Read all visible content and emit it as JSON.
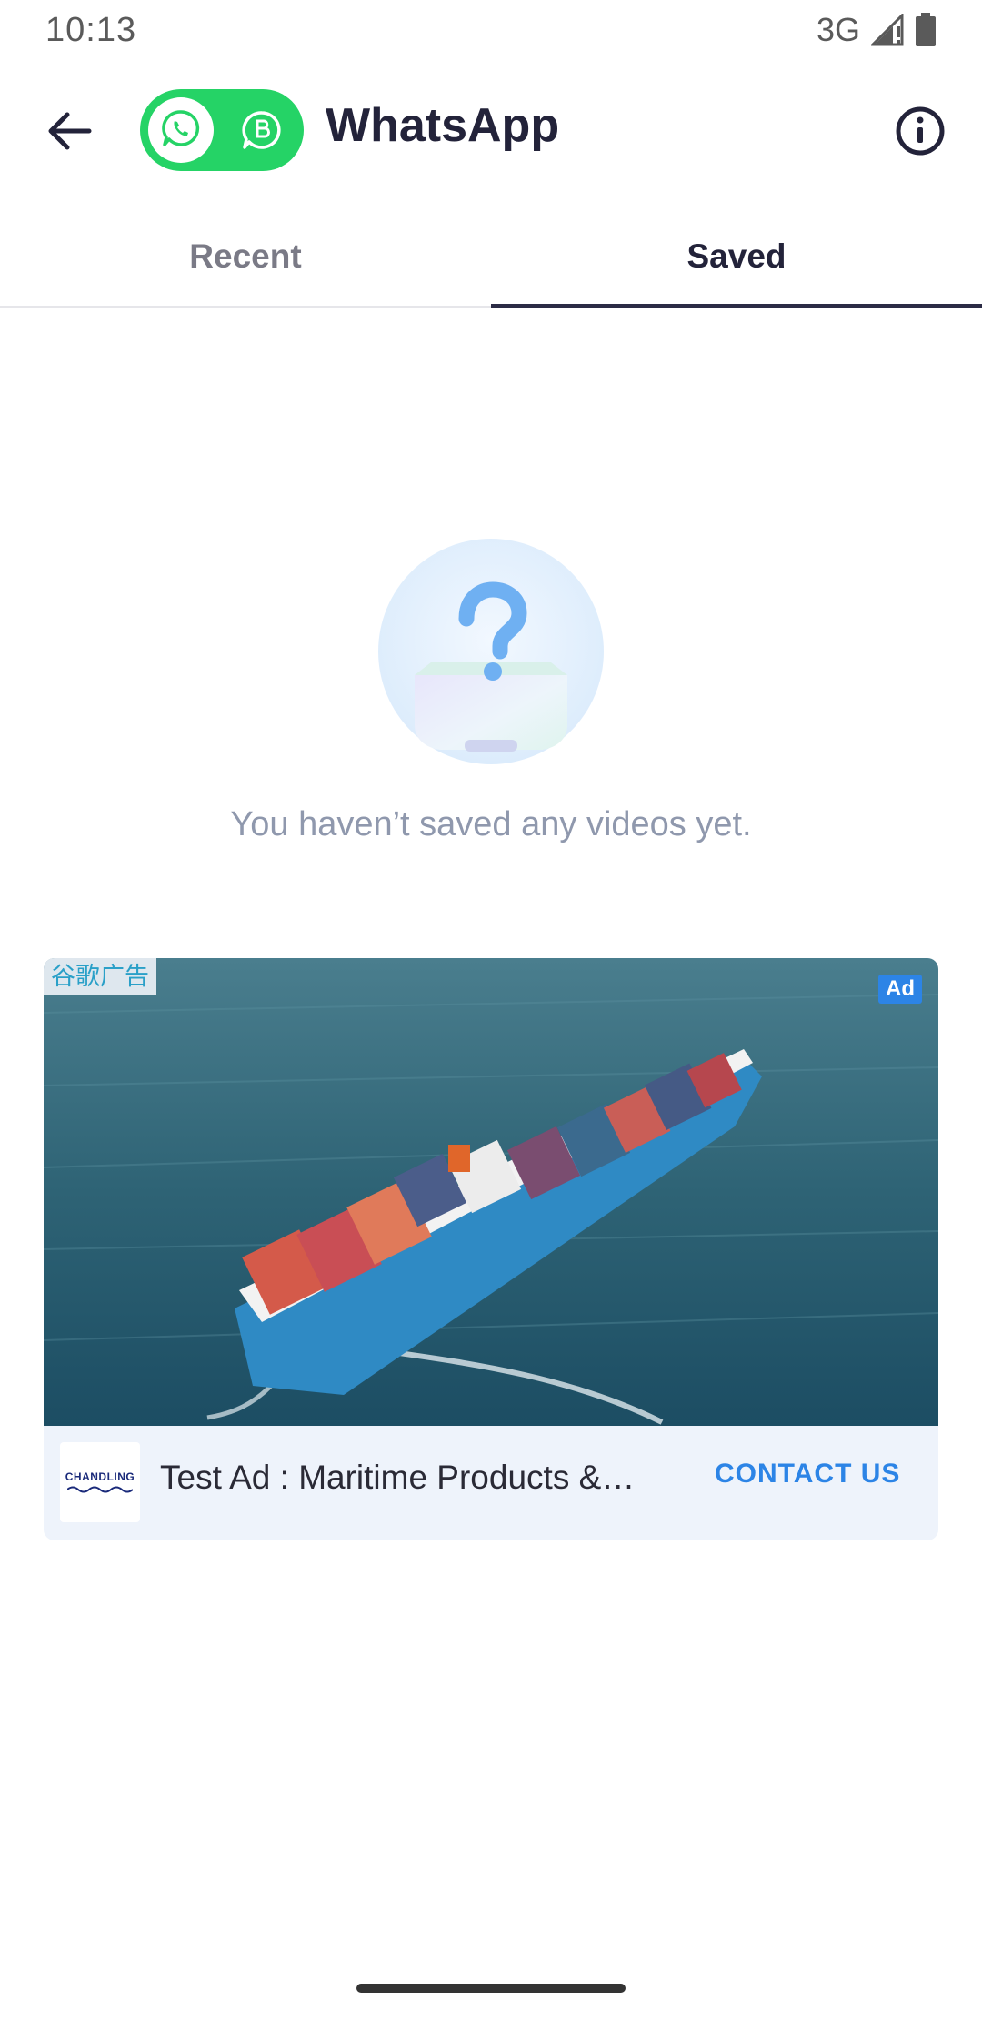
{
  "status_bar": {
    "time": "10:13",
    "network": "3G",
    "icons": [
      "signal-icon",
      "battery-icon"
    ]
  },
  "app_bar": {
    "title": "WhatsApp",
    "back_icon": "arrow-left-icon",
    "toggle_icons": [
      "whatsapp-icon",
      "whatsapp-business-icon"
    ],
    "info_icon": "info-icon",
    "accent_color": "#25d366"
  },
  "tabs": [
    {
      "label": "Recent",
      "selected": false
    },
    {
      "label": "Saved",
      "selected": true
    }
  ],
  "empty_state": {
    "icon": "question-box-icon",
    "message": "You haven’t saved any videos yet."
  },
  "ad": {
    "network_label": "谷歌广告",
    "badge": "Ad",
    "image": "container-ship-image",
    "logo_text": "CHANDLING",
    "headline": "Test Ad : Maritime Products &…",
    "cta": "CONTACT US",
    "cta_color": "#2c84e6"
  }
}
